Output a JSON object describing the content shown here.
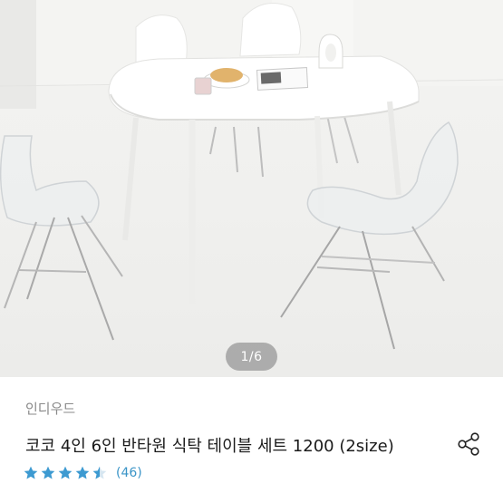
{
  "gallery": {
    "image_alt": "White semicircular dining table with clear acrylic and white chairs",
    "page_indicator": "1/6"
  },
  "product": {
    "brand": "인디우드",
    "title": "코코 4인 6인 반타원 식탁 테이블 세트 1200 (2size)",
    "rating": 4.5,
    "rating_max": 5,
    "review_count": "(46)"
  },
  "icons": {
    "share": "share-icon",
    "star": "star-icon"
  },
  "colors": {
    "star": "#3d9ad1",
    "review_count": "#3a94c7",
    "brand": "#8a8a8a"
  }
}
